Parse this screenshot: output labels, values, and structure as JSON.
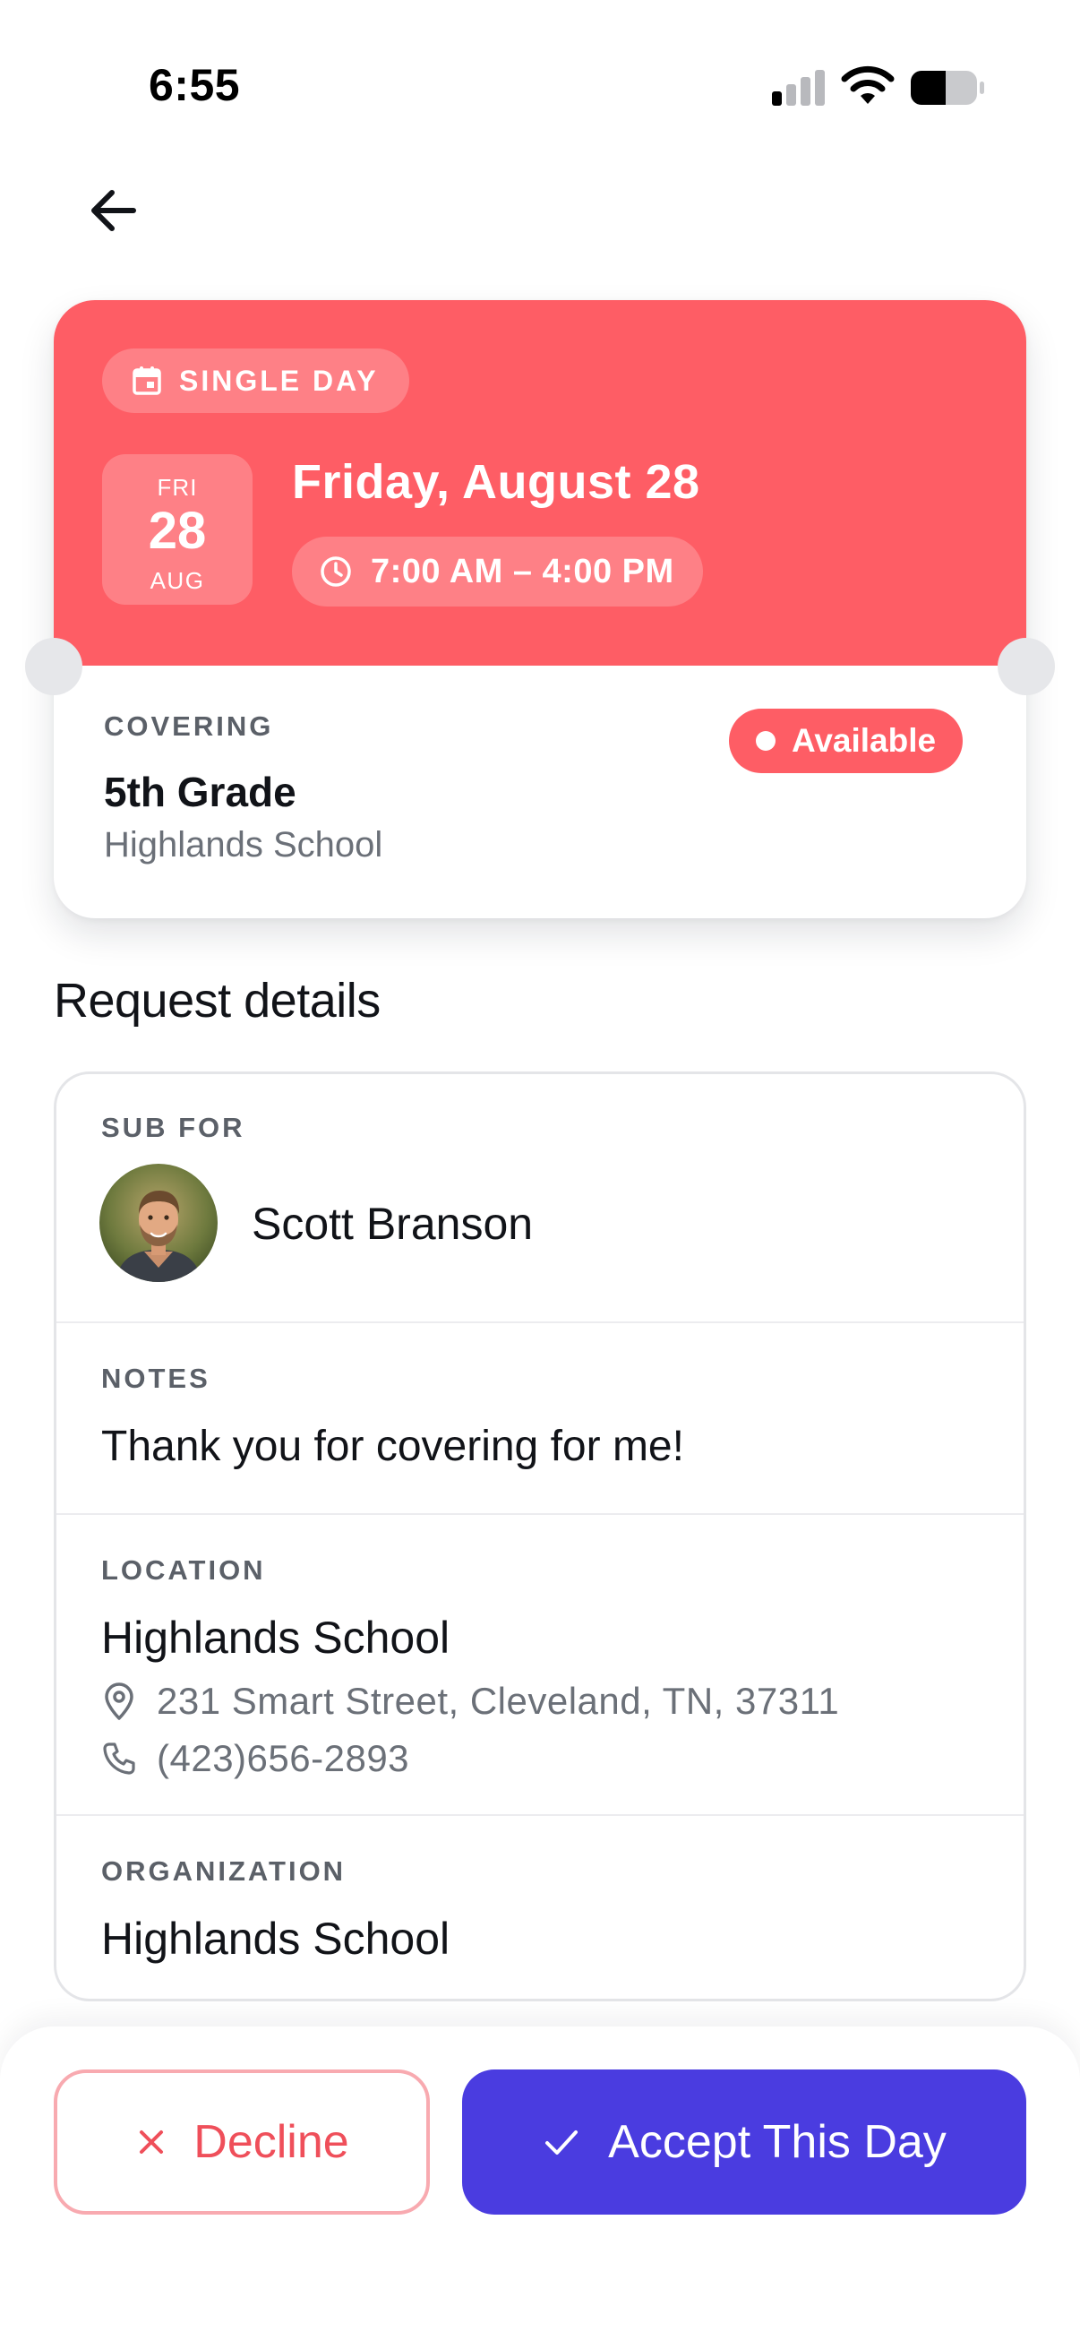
{
  "status_bar": {
    "time": "6:55"
  },
  "header": {
    "back_icon": "arrow-left-icon"
  },
  "assignment": {
    "type_label": "SINGLE DAY",
    "type_icon": "calendar-icon",
    "day_of_week": "FRI",
    "day": "28",
    "month": "AUG",
    "full_date": "Friday, August 28",
    "time_range": "7:00 AM – 4:00 PM",
    "time_icon": "clock-icon",
    "covering_label": "COVERING",
    "covering_title": "5th Grade",
    "covering_school": "Highlands School",
    "status": "Available",
    "accent_color": "#fe5d65"
  },
  "details": {
    "section_title": "Request details",
    "sub_for_label": "SUB FOR",
    "sub_for_name": "Scott Branson",
    "notes_label": "NOTES",
    "notes_text": "Thank you for covering for me!",
    "location_label": "LOCATION",
    "location_name": "Highlands School",
    "location_address": "231 Smart Street, Cleveland, TN, 37311",
    "location_phone": "(423)656-2893",
    "organization_label": "ORGANIZATION",
    "organization_name": "Highlands School"
  },
  "actions": {
    "decline_label": "Decline",
    "accept_label": "Accept This Day",
    "accept_color": "#4a3ce0"
  }
}
